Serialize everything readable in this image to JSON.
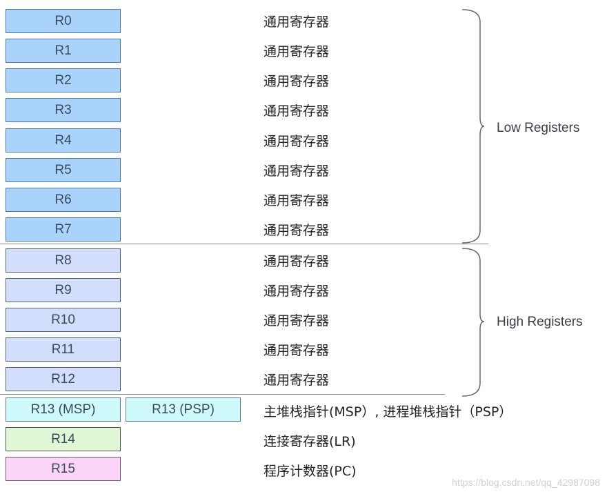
{
  "registers": [
    {
      "name": "R0",
      "desc": "通用寄存器",
      "group": "low"
    },
    {
      "name": "R1",
      "desc": "通用寄存器",
      "group": "low"
    },
    {
      "name": "R2",
      "desc": "通用寄存器",
      "group": "low"
    },
    {
      "name": "R3",
      "desc": "通用寄存器",
      "group": "low"
    },
    {
      "name": "R4",
      "desc": "通用寄存器",
      "group": "low"
    },
    {
      "name": "R5",
      "desc": "通用寄存器",
      "group": "low"
    },
    {
      "name": "R6",
      "desc": "通用寄存器",
      "group": "low"
    },
    {
      "name": "R7",
      "desc": "通用寄存器",
      "group": "low"
    },
    {
      "name": "R8",
      "desc": "通用寄存器",
      "group": "high"
    },
    {
      "name": "R9",
      "desc": "通用寄存器",
      "group": "high"
    },
    {
      "name": "R10",
      "desc": "通用寄存器",
      "group": "high"
    },
    {
      "name": "R11",
      "desc": "通用寄存器",
      "group": "high"
    },
    {
      "name": "R12",
      "desc": "通用寄存器",
      "group": "high"
    }
  ],
  "special": {
    "r13_msp": "R13 (MSP)",
    "r13_psp": "R13 (PSP)",
    "r13_desc": "主堆栈指针(MSP）, 进程堆栈指针（PSP）",
    "r14": "R14",
    "r14_desc": "连接寄存器(LR)",
    "r15": "R15",
    "r15_desc": "程序计数器(PC)"
  },
  "groups": {
    "low_label": "Low Registers",
    "high_label": "High Registers"
  },
  "colors": {
    "low": "#a9d3fb",
    "high": "#d2defc",
    "sp": "#cffafb",
    "lr": "#e0f7d6",
    "pc": "#fbd5f7"
  },
  "watermark": "https://blog.csdn.net/qq_42987098"
}
